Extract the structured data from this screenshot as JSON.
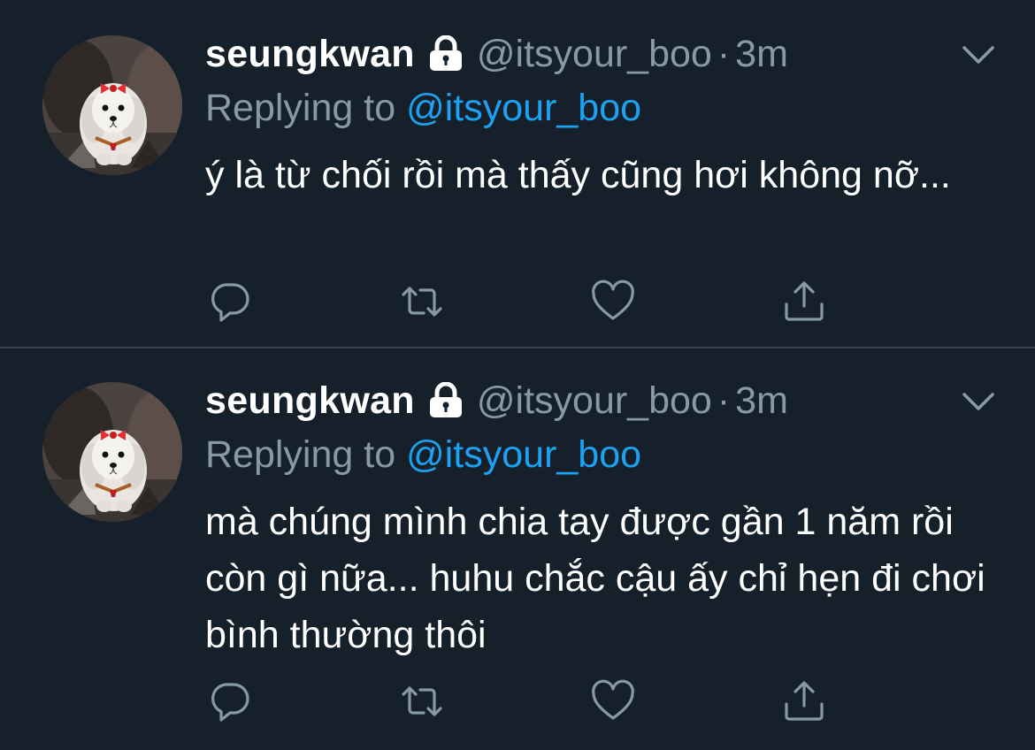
{
  "colors": {
    "background": "#15202b",
    "divider": "#38444d",
    "primary_text": "#ffffff",
    "secondary_text": "#8899a6",
    "accent": "#1da1f2"
  },
  "tweets": [
    {
      "avatar_icon": "dog-avatar",
      "display_name": "seungkwan",
      "protected_icon": "lock-icon",
      "handle": "@itsyour_boo",
      "separator": "·",
      "time": "3m",
      "menu_icon": "chevron-down-icon",
      "replying_prefix": "Replying to",
      "replying_to": "@itsyour_boo",
      "text": "ý là từ chối rồi mà thấy cũng hơi không nỡ...",
      "actions": [
        "reply-icon",
        "retweet-icon",
        "like-icon",
        "share-icon"
      ]
    },
    {
      "avatar_icon": "dog-avatar",
      "display_name": "seungkwan",
      "protected_icon": "lock-icon",
      "handle": "@itsyour_boo",
      "separator": "·",
      "time": "3m",
      "menu_icon": "chevron-down-icon",
      "replying_prefix": "Replying to",
      "replying_to": "@itsyour_boo",
      "text": "mà chúng mình chia tay được gần 1 năm rồi còn gì nữa... huhu chắc cậu ấy chỉ hẹn đi chơi bình thường thôi",
      "actions": [
        "reply-icon",
        "retweet-icon",
        "like-icon",
        "share-icon"
      ]
    }
  ]
}
